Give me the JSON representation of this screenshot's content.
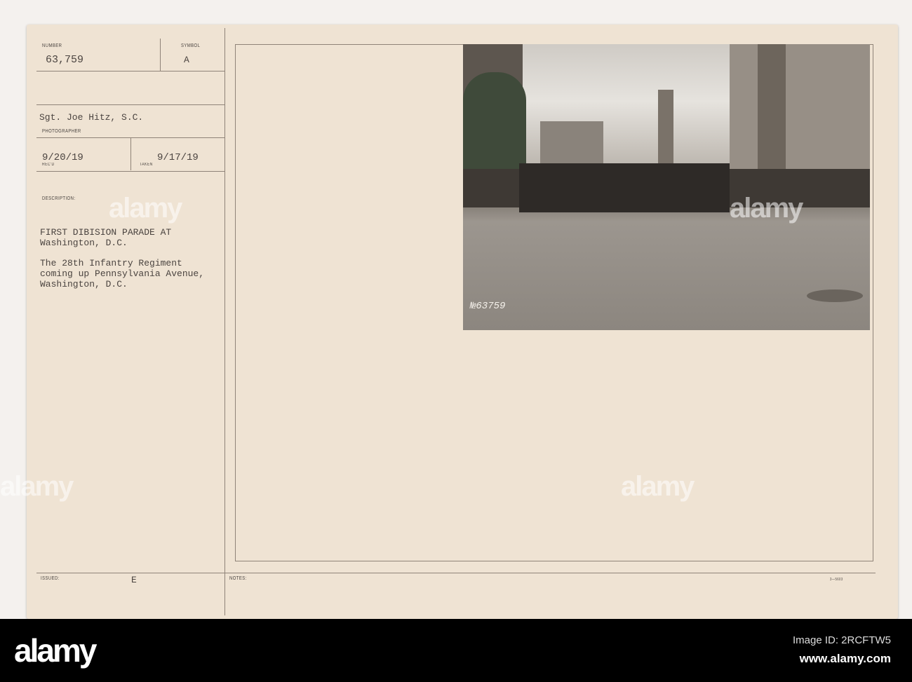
{
  "card": {
    "number_label": "NUMBER",
    "number": "63,759",
    "symbol_label": "SYMBOL",
    "symbol": "A",
    "photographer": "Sgt. Joe Hitz, S.C.",
    "photographer_label": "PHOTOGRAPHER",
    "recd": "9/20/19",
    "recd_label": "REC'D",
    "taken_label": "TAKEN",
    "taken": "9/17/19",
    "description_label": "DESCRIPTION:",
    "description_lines": [
      "FIRST DIBISION PARADE AT",
      "Washington, D.C.",
      "",
      "The 28th Infantry Regiment",
      "coming up Pennsylvania Avenue,",
      "Washington, D.C."
    ],
    "issued_label": "ISSUED:",
    "issued": "E",
    "notes_label": "NOTES:",
    "form_code": "3—5603",
    "photo_number": "№63759"
  },
  "watermark": {
    "text": "alamy"
  },
  "footer": {
    "logo": "alamy",
    "image_id": "Image ID: 2RCFTW5",
    "url": "www.alamy.com"
  }
}
